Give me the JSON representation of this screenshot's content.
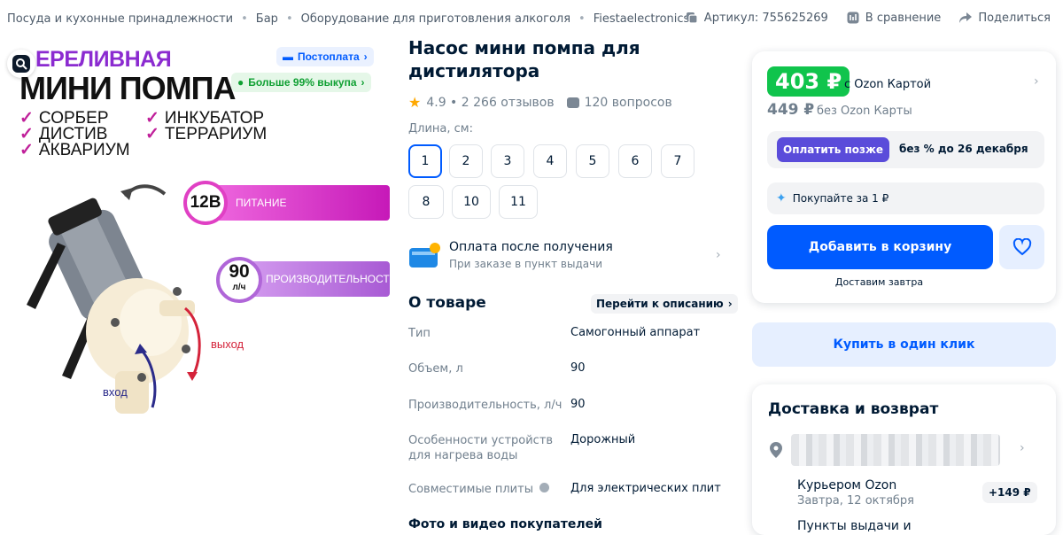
{
  "breadcrumbs": [
    "Посуда и кухонные принадлежности",
    "Бар",
    "Оборудование для приготовления алкоголя",
    "Fiestaelectronics"
  ],
  "breadcrumb_separator": "•",
  "top_actions": {
    "article": "Артикул: 755625269",
    "compare": "В сравнение",
    "share": "Поделиться"
  },
  "product_image": {
    "headline1": "ЕРЕЛИВНАЯ",
    "headline2": "МИНИ ПОМПА",
    "badge_postpay": "Постоплата",
    "badge_buyout": "Больше 99% выкупа",
    "checklist_left": [
      "СОРБЕР",
      "ДИСТИВ",
      "АКВАРИУМ"
    ],
    "checklist_right": [
      "ИНКУБАТОР",
      "ТЕРРАРИУМ"
    ],
    "check_mark": "✓",
    "power_value": "12В",
    "power_label": "ПИТАНИЕ",
    "capacity_value": "90",
    "capacity_unit": "л/ч",
    "capacity_label": "ПРОИЗВОДИТЕЛЬНОСТЬ",
    "outlet_label": "выход",
    "inlet_label": "вход"
  },
  "product": {
    "title": "Насос мини помпа для дистилятора",
    "rating_text": "4.9 • 2 266 отзывов",
    "questions": "120 вопросов",
    "length_label": "Длина, см:",
    "sizes": [
      "1",
      "2",
      "3",
      "4",
      "5",
      "6",
      "7",
      "8",
      "10",
      "11"
    ],
    "selected_size": "1"
  },
  "payment": {
    "title": "Оплата после получения",
    "subtitle": "При заказе в пункт выдачи"
  },
  "about": {
    "heading": "О товаре",
    "goto_label": "Перейти к описанию",
    "specs": [
      {
        "key": "Тип",
        "value": "Самогонный аппарат"
      },
      {
        "key": "Объем, л",
        "value": "90"
      },
      {
        "key": "Производительность, л/ч",
        "value": "90"
      },
      {
        "key": "Особенности устройств для нагрева воды",
        "value": "Дорожный"
      },
      {
        "key": "Совместимые плиты",
        "value": "Для электрических плит"
      }
    ],
    "photos_heading": "Фото и видео покупателей"
  },
  "buy_card": {
    "price_card": "403 ₽",
    "price_card_note": "с Ozon Картой",
    "price_regular": "449 ₽",
    "price_regular_note": "без Ozon Карты",
    "pay_later_button": "Оплатить позже",
    "pay_later_text": "без % до 26 декабря",
    "buy_for_one": "Покупайте за 1 ₽",
    "add_to_cart": "Добавить в корзину",
    "delivery_note": "Доставим завтра",
    "one_click": "Купить в один клик"
  },
  "delivery": {
    "heading": "Доставка и возврат",
    "courier_title": "Курьером Ozon",
    "courier_date": "Завтра, 12 октября",
    "courier_price": "+149 ₽",
    "pickup_title": "Пункты выдачи и"
  },
  "colors": {
    "accent": "#005bff",
    "price_green": "#10c44c",
    "pay_later": "#5a4cda"
  }
}
